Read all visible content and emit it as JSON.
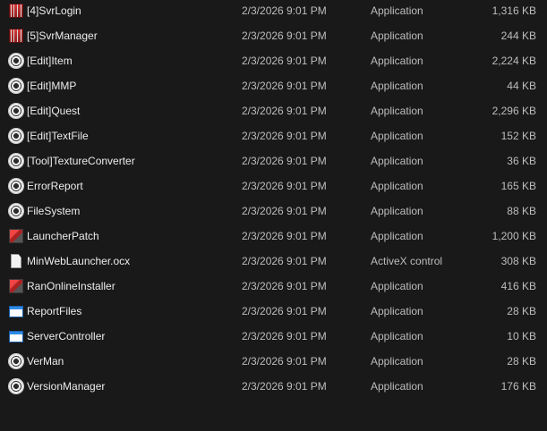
{
  "files": [
    {
      "name": "[4]SvrLogin",
      "date": "2/3/2026 9:01 PM",
      "type": "Application",
      "size": "1,316 KB",
      "icon": "red-app-icon"
    },
    {
      "name": "[5]SvrManager",
      "date": "2/3/2026 9:01 PM",
      "type": "Application",
      "size": "244 KB",
      "icon": "red-app-icon"
    },
    {
      "name": "[Edit]Item",
      "date": "2/3/2026 9:01 PM",
      "type": "Application",
      "size": "2,224 KB",
      "icon": "gear-app-icon"
    },
    {
      "name": "[Edit]MMP",
      "date": "2/3/2026 9:01 PM",
      "type": "Application",
      "size": "44 KB",
      "icon": "gear-app-icon"
    },
    {
      "name": "[Edit]Quest",
      "date": "2/3/2026 9:01 PM",
      "type": "Application",
      "size": "2,296 KB",
      "icon": "gear-app-icon"
    },
    {
      "name": "[Edit]TextFile",
      "date": "2/3/2026 9:01 PM",
      "type": "Application",
      "size": "152 KB",
      "icon": "gear-app-icon"
    },
    {
      "name": "[Tool]TextureConverter",
      "date": "2/3/2026 9:01 PM",
      "type": "Application",
      "size": "36 KB",
      "icon": "gear-app-icon"
    },
    {
      "name": "ErrorReport",
      "date": "2/3/2026 9:01 PM",
      "type": "Application",
      "size": "165 KB",
      "icon": "gear-app-icon"
    },
    {
      "name": "FileSystem",
      "date": "2/3/2026 9:01 PM",
      "type": "Application",
      "size": "88 KB",
      "icon": "gear-app-icon"
    },
    {
      "name": "LauncherPatch",
      "date": "2/3/2026 9:01 PM",
      "type": "Application",
      "size": "1,200 KB",
      "icon": "installer-app-icon"
    },
    {
      "name": "MinWebLauncher.ocx",
      "date": "2/3/2026 9:01 PM",
      "type": "ActiveX control",
      "size": "308 KB",
      "icon": "file-icon"
    },
    {
      "name": "RanOnlineInstaller",
      "date": "2/3/2026 9:01 PM",
      "type": "Application",
      "size": "416 KB",
      "icon": "installer-app-icon"
    },
    {
      "name": "ReportFiles",
      "date": "2/3/2026 9:01 PM",
      "type": "Application",
      "size": "28 KB",
      "icon": "window-app-icon"
    },
    {
      "name": "ServerController",
      "date": "2/3/2026 9:01 PM",
      "type": "Application",
      "size": "10 KB",
      "icon": "window-app-icon"
    },
    {
      "name": "VerMan",
      "date": "2/3/2026 9:01 PM",
      "type": "Application",
      "size": "28 KB",
      "icon": "gear-app-icon"
    },
    {
      "name": "VersionManager",
      "date": "2/3/2026 9:01 PM",
      "type": "Application",
      "size": "176 KB",
      "icon": "gear-app-icon"
    }
  ]
}
